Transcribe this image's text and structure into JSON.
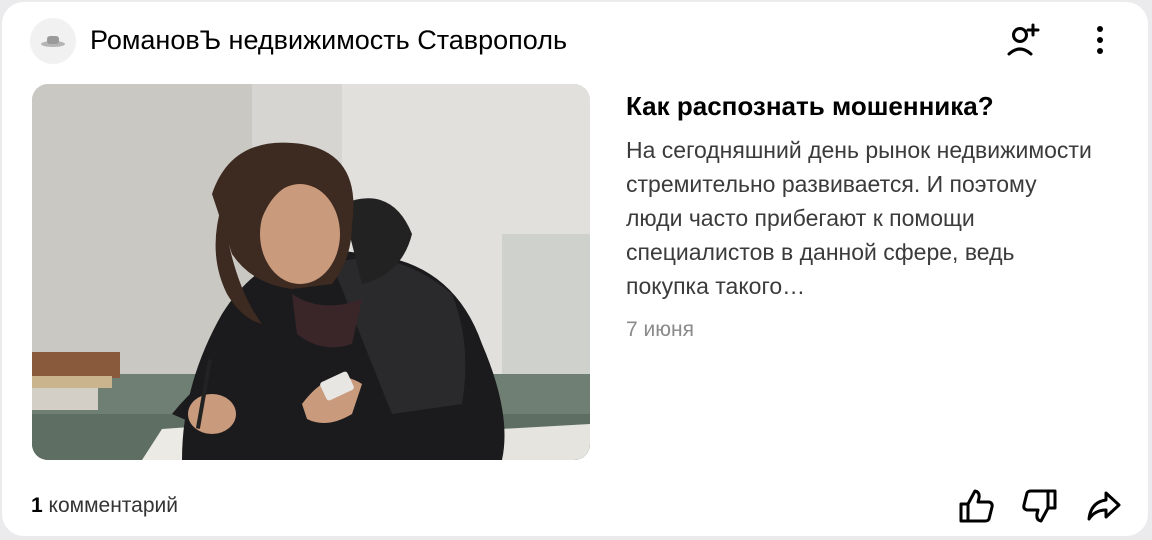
{
  "channel": {
    "name": "РомановЪ недвижимость Ставрополь",
    "avatar_icon": "hat-logo-icon"
  },
  "header_actions": {
    "subscribe_icon": "add-person-icon",
    "more_icon": "vertical-dots-icon"
  },
  "article": {
    "title": "Как распознать мошенника?",
    "snippet": "На сегодняшний день рынок недвижимости стремительно развивается. И поэтому люди часто прибегают к помощи специалистов в данной сфере, ведь покупка такого…",
    "date": "7 июня",
    "image": "photo of a man with long hair in a leather jacket writing at a desk"
  },
  "footer": {
    "comments_count": "1",
    "comments_label": "комментарий",
    "like_icon": "thumbs-up-icon",
    "dislike_icon": "thumbs-down-icon",
    "share_icon": "share-arrow-icon"
  },
  "colors": {
    "background": "#ebebed",
    "card": "#ffffff",
    "snippet_text": "#3b3b3b",
    "date_text": "#8a8a8a"
  }
}
